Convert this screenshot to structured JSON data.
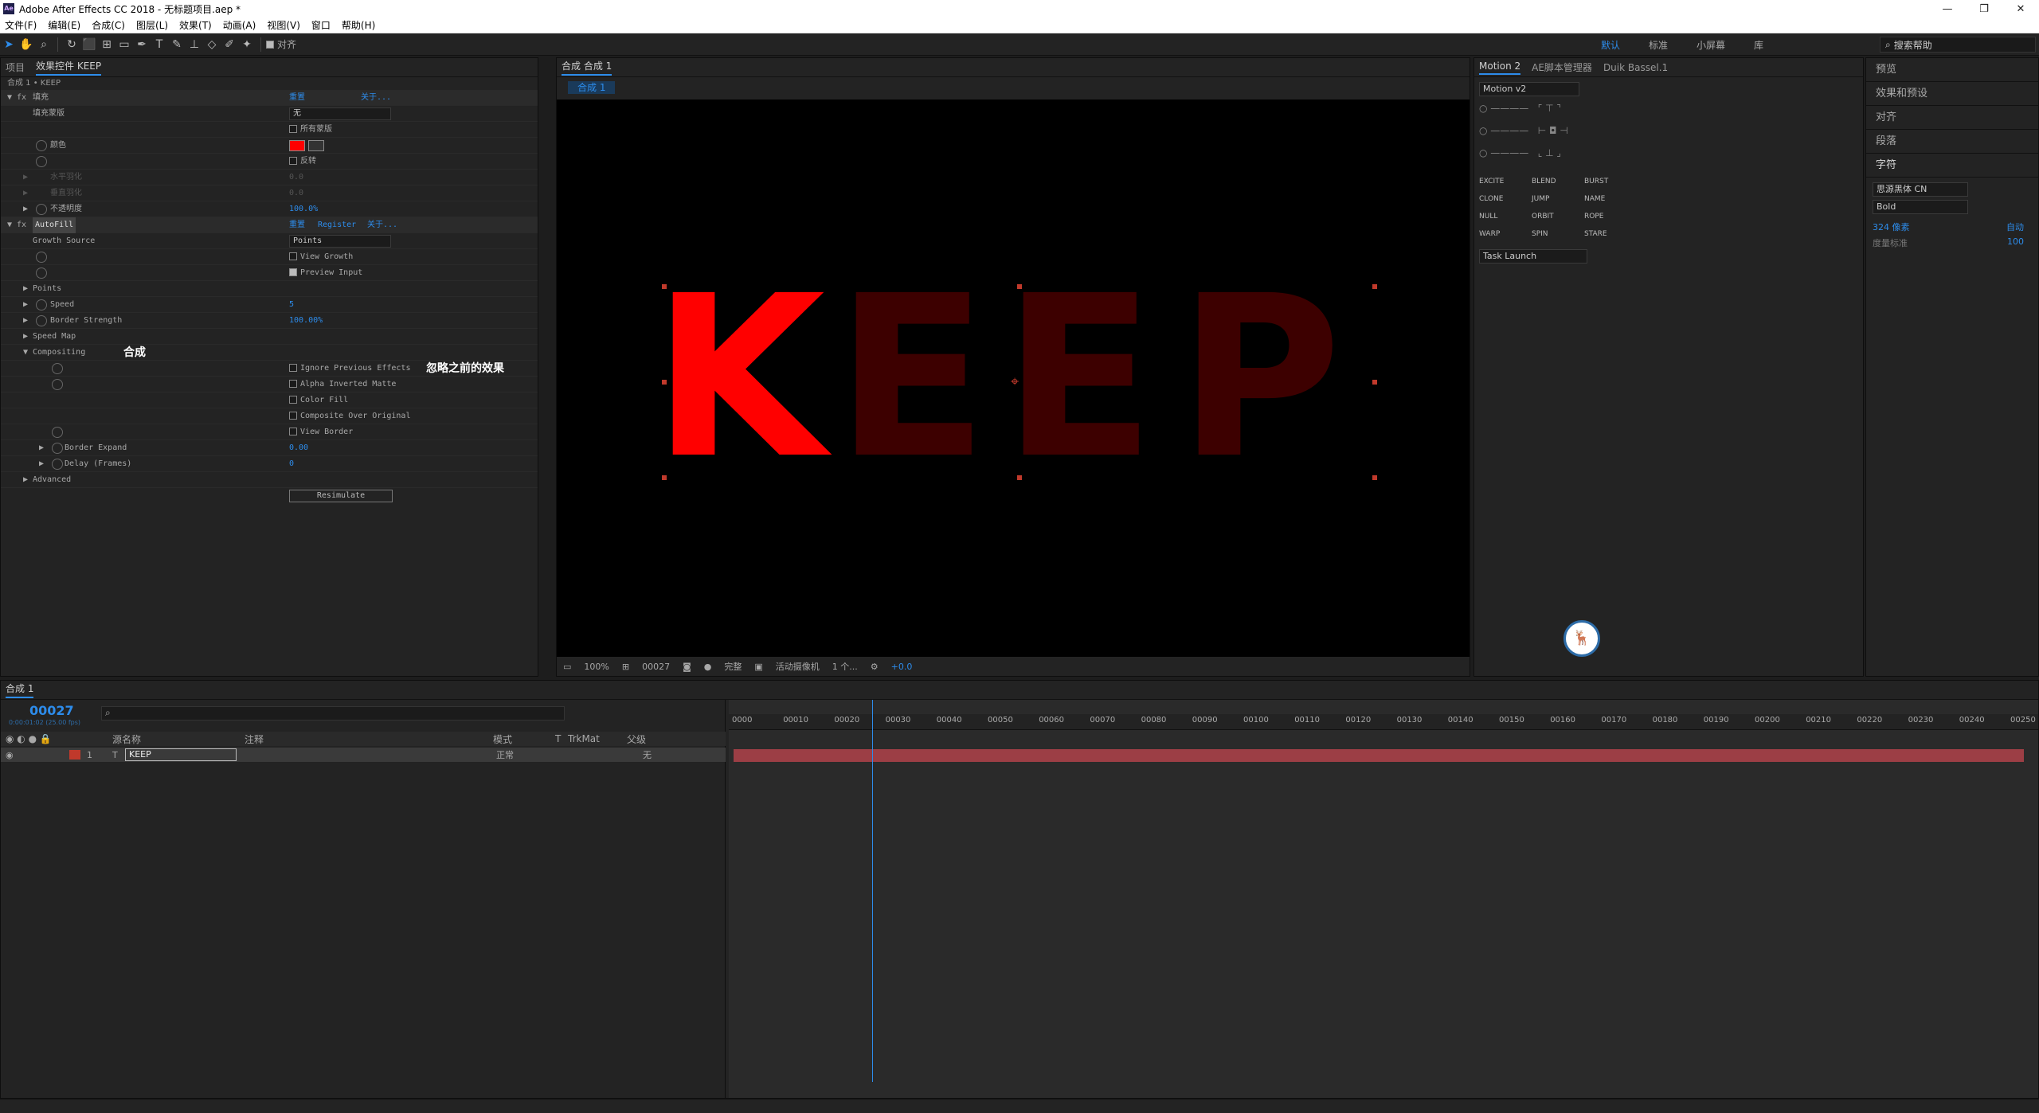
{
  "app": {
    "title": "Adobe After Effects CC 2018 - 无标题项目.aep *",
    "logo": "Ae"
  },
  "menu": [
    "文件(F)",
    "编辑(E)",
    "合成(C)",
    "图层(L)",
    "效果(T)",
    "动画(A)",
    "视图(V)",
    "窗口",
    "帮助(H)"
  ],
  "toolbar": {
    "align_label": "对齐"
  },
  "workspaces": [
    "默认",
    "标准",
    "小屏幕",
    "库"
  ],
  "search_help": "搜索帮助",
  "ec": {
    "tabs": [
      "项目",
      "效果控件 KEEP"
    ],
    "sub": "合成 1 • KEEP",
    "fill": {
      "name": "填充",
      "reset": "重置",
      "about": "关于...",
      "mask_label": "填充蒙版",
      "mask_val": "无",
      "all_masks": "所有蒙版",
      "color_label": "颜色",
      "invert": "反转",
      "h_feather": "水平羽化",
      "h_val": "0.0",
      "v_feather": "垂直羽化",
      "v_val": "0.0",
      "opacity": "不透明度",
      "opacity_val": "100.0%"
    },
    "autofill": {
      "name": "AutoFill",
      "reset": "重置",
      "register": "Register",
      "about": "关于...",
      "growth_source": "Growth Source",
      "growth_val": "Points",
      "view_growth": "View Growth",
      "preview_input": "Preview Input",
      "points": "Points",
      "speed": "Speed",
      "speed_val": "5",
      "border_strength": "Border Strength",
      "border_val": "100.00%",
      "speed_map": "Speed Map",
      "compositing": "Compositing",
      "ignore": "Ignore Previous Effects",
      "alpha_inv": "Alpha Inverted Matte",
      "color_fill": "Color Fill",
      "comp_over": "Composite Over Original",
      "view_border": "View Border",
      "border_expand": "Border Expand",
      "expand_val": "0.00",
      "delay": "Delay (Frames)",
      "delay_val": "0",
      "advanced": "Advanced",
      "resimulate": "Resimulate"
    },
    "ann1": "合成",
    "ann2": "忽略之前的效果"
  },
  "comp": {
    "tab": "合成 合成 1",
    "sub_tab": "合成 1",
    "letters": [
      "K",
      "E",
      "E",
      "P"
    ],
    "zoom": "100%",
    "time": "00027",
    "quality": "完整",
    "camera": "活动摄像机",
    "views": "1 个...",
    "exposure": "+0.0"
  },
  "motion": {
    "tabs": [
      "Motion 2",
      "AE脚本管理器",
      "Duik Bassel.1"
    ],
    "version": "Motion v2",
    "btns": [
      "EXCITE",
      "BLEND",
      "BURST",
      "CLONE",
      "JUMP",
      "NAME",
      "NULL",
      "ORBIT",
      "ROPE",
      "WARP",
      "SPIN",
      "STARE"
    ],
    "task": "Task Launch"
  },
  "right": {
    "items": [
      "预览",
      "效果和预设",
      "对齐",
      "段落",
      "字符"
    ],
    "font": "思源黑体 CN",
    "style": "Bold",
    "size": "324 像素",
    "leading": "自动",
    "kern_label": "度量标准",
    "tracking": "100"
  },
  "timeline": {
    "tab": "合成 1",
    "time": "00027",
    "fps": "0:00:01:02 (25.00 fps)",
    "cols": [
      "源名称",
      "注释",
      "模式",
      "T",
      "TrkMat",
      "父级"
    ],
    "layer_num": "1",
    "layer_name": "KEEP",
    "mode": "正常",
    "parent": "无",
    "ticks": [
      "0000",
      "00010",
      "00020",
      "00030",
      "00040",
      "00050",
      "00060",
      "00070",
      "00080",
      "00090",
      "00100",
      "00110",
      "00120",
      "00130",
      "00140",
      "00150",
      "00160",
      "00170",
      "00180",
      "00190",
      "00200",
      "00210",
      "00220",
      "00230",
      "00240",
      "00250"
    ]
  }
}
